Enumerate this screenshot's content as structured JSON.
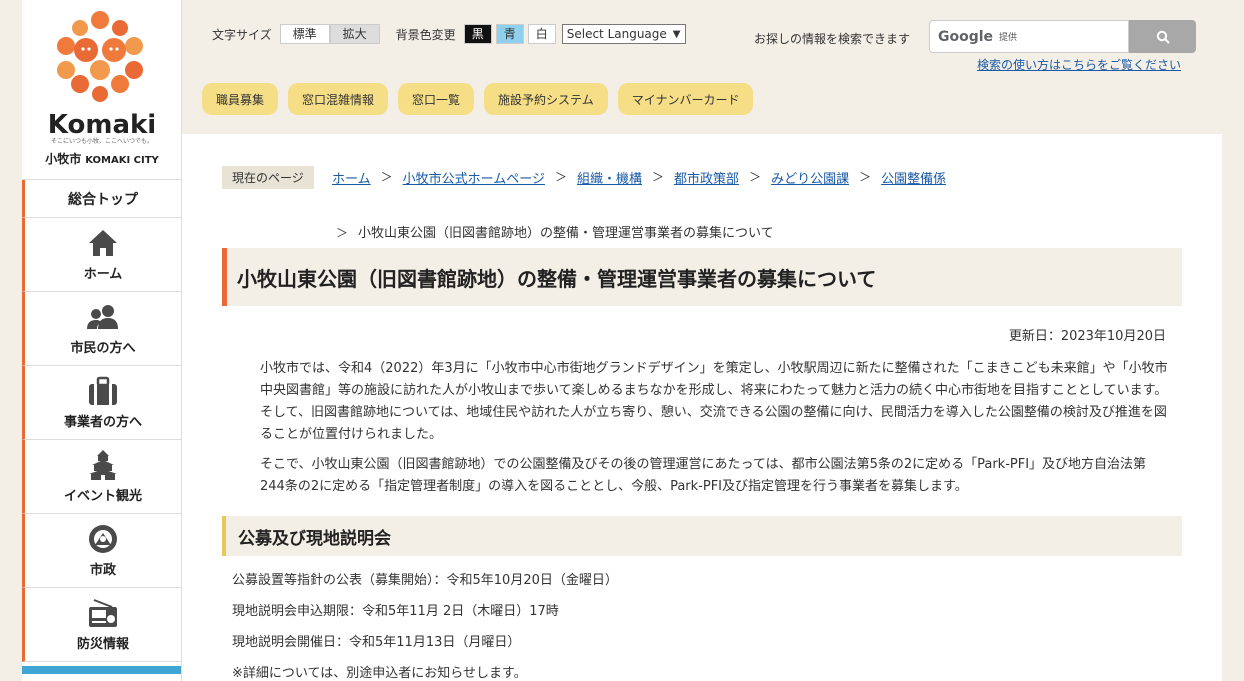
{
  "logo": {
    "word": "Komaki",
    "tagline": "そこにいつも小牧、ここへいつでも。",
    "city_ja": "小牧市",
    "city_en": "KOMAKI CITY"
  },
  "sidebar": {
    "top_label": "総合トップ",
    "items": [
      {
        "label": "ホーム",
        "icon": "home-icon"
      },
      {
        "label": "市民の方へ",
        "icon": "people-icon"
      },
      {
        "label": "事業者の方へ",
        "icon": "briefcase-icon"
      },
      {
        "label": "イベント観光",
        "icon": "castle-icon"
      },
      {
        "label": "市政",
        "icon": "emblem-icon"
      },
      {
        "label": "防災情報",
        "icon": "radio-icon"
      }
    ]
  },
  "header": {
    "font_size_label": "文字サイズ",
    "font_standard": "標準",
    "font_large": "拡大",
    "bg_label": "背景色変更",
    "bg_black": "黒",
    "bg_blue": "青",
    "bg_white": "白",
    "language": "Select Language",
    "search_label": "お探しの情報を検索できます",
    "search_brand": "Google",
    "search_provided": "提供",
    "search_help": "検索の使い方はこちらをご覧ください",
    "quick_links": [
      "職員募集",
      "窓口混雑情報",
      "窓口一覧",
      "施設予約システム",
      "マイナンバーカード"
    ]
  },
  "breadcrumb": {
    "label": "現在のページ",
    "links": [
      "ホーム",
      "小牧市公式ホームページ",
      "組織・機構",
      "都市政策部",
      "みどり公園課",
      "公園整備係"
    ],
    "current": "小牧山東公園（旧図書館跡地）の整備・管理運営事業者の募集について"
  },
  "content": {
    "title": "小牧山東公園（旧図書館跡地）の整備・管理運営事業者の募集について",
    "updated": "更新日：2023年10月20日",
    "para1": "小牧市では、令和4（2022）年3月に「小牧市中心市街地グランドデザイン」を策定し、小牧駅周辺に新たに整備された「こまきこども未来館」や「小牧市中央図書館」等の施設に訪れた人が小牧山まで歩いて楽しめるまちなかを形成し、将来にわたって魅力と活力の続く中心市街地を目指すこととしています。そして、旧図書館跡地については、地域住民や訪れた人が立ち寄り、憩い、交流できる公園の整備に向け、民間活力を導入した公園整備の検討及び推進を図ることが位置付けられました。",
    "para2": "そこで、小牧山東公園（旧図書館跡地）での公園整備及びその後の管理運営にあたっては、都市公園法第5条の2に定める「Park-PFI」及び地方自治法第244条の2に定める「指定管理者制度」の導入を図ることとし、今般、Park-PFI及び指定管理を行う事業者を募集します。",
    "section_title": "公募及び現地説明会",
    "info": [
      "公募設置等指針の公表（募集開始）：令和5年10月20日（金曜日）",
      "現地説明会申込期限：令和5年11月 2日（木曜日）17時",
      "現地説明会開催日：令和5年11月13日（月曜日）",
      "※詳細については、別途申込者にお知らせします。"
    ]
  },
  "colors": {
    "accent": "#e96a35",
    "quick_bg": "#f5de86",
    "header_bg": "#f3efe7",
    "link": "#1a5aa6"
  }
}
